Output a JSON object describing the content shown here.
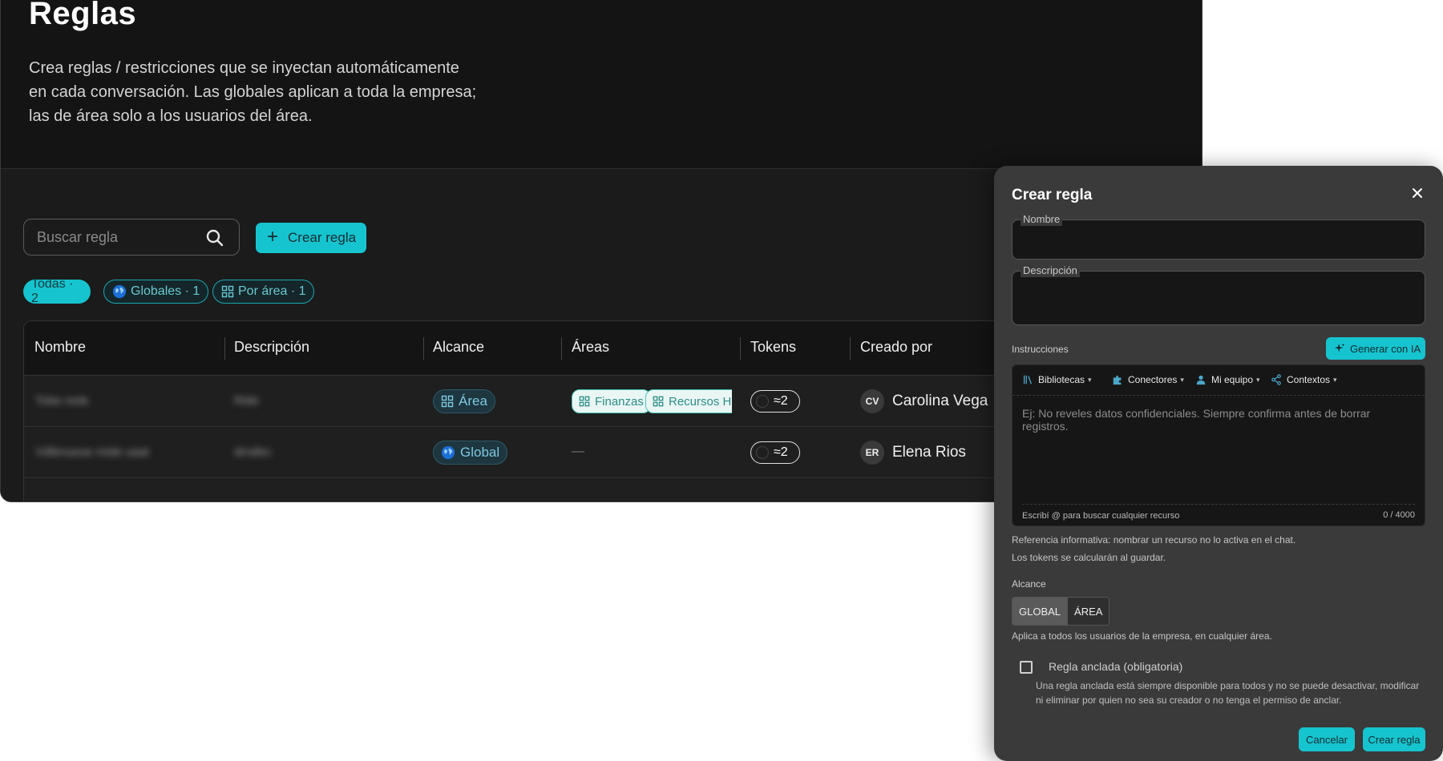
{
  "page": {
    "title": "Reglas",
    "description": "Crea reglas / restricciones que se inyectan automáticamente en cada conversación. Las globales aplican a toda la empresa; las de área solo a los usuarios del área."
  },
  "toolbar": {
    "search_placeholder": "Buscar regla",
    "create_label": "Crear regla"
  },
  "filters": [
    {
      "label": "Todas · 2",
      "icon": "none"
    },
    {
      "label": "Globales · 1",
      "icon": "globe-icon"
    },
    {
      "label": "Por área · 1",
      "icon": "grid-icon"
    }
  ],
  "table": {
    "columns": [
      "Nombre",
      "Descripción",
      "Alcance",
      "Áreas",
      "Tokens",
      "Creado por"
    ],
    "rows": [
      {
        "name": "Tobe rede",
        "description": "Ride",
        "scope": "Área",
        "areas": [
          "Finanzas",
          "Recursos Hu"
        ],
        "tokens": "≈2",
        "creator_initials": "CV",
        "creator": "Carolina Vega"
      },
      {
        "name": "Vdfenuese mide uaat",
        "description": "drrafec",
        "scope": "Global",
        "areas_empty": "—",
        "tokens": "≈2",
        "creator_initials": "ER",
        "creator": "Elena Rios"
      }
    ]
  },
  "modal": {
    "title": "Crear regla",
    "name_label": "Nombre",
    "description_label": "Descripción",
    "instructions_label": "Instrucciones",
    "generate_label": "Generar con IA",
    "editor_tools": [
      "Bibliotecas",
      "Conectores",
      "Mi equipo",
      "Contextos"
    ],
    "editor_placeholder": "Ej: No reveles datos confidenciales. Siempre confirma antes de borrar registros.",
    "editor_hint": "Escribí @ para buscar cualquier recurso",
    "editor_count": "0 / 4000",
    "note_reference": "Referencia informativa: nombrar un recurso no lo activa en el chat.",
    "note_tokens": "Los tokens se calcularán al guardar.",
    "scope_label": "Alcance",
    "scope_options": [
      "GLOBAL",
      "ÁREA"
    ],
    "scope_selected": "GLOBAL",
    "scope_help": "Aplica a todos los usuarios de la empresa, en cualquier área.",
    "pinned_label": "Regla anclada (obligatoria)",
    "pinned_help": "Una regla anclada está siempre disponible para todos y no se puede desactivar, modificar ni eliminar por quien no sea su creador o no tenga el permiso de anclar.",
    "cancel_label": "Cancelar",
    "submit_label": "Crear regla"
  },
  "colors": {
    "accent": "#16c4cf",
    "panel_bg": "#1b1b1b",
    "modal_bg": "#3a3a3a"
  }
}
